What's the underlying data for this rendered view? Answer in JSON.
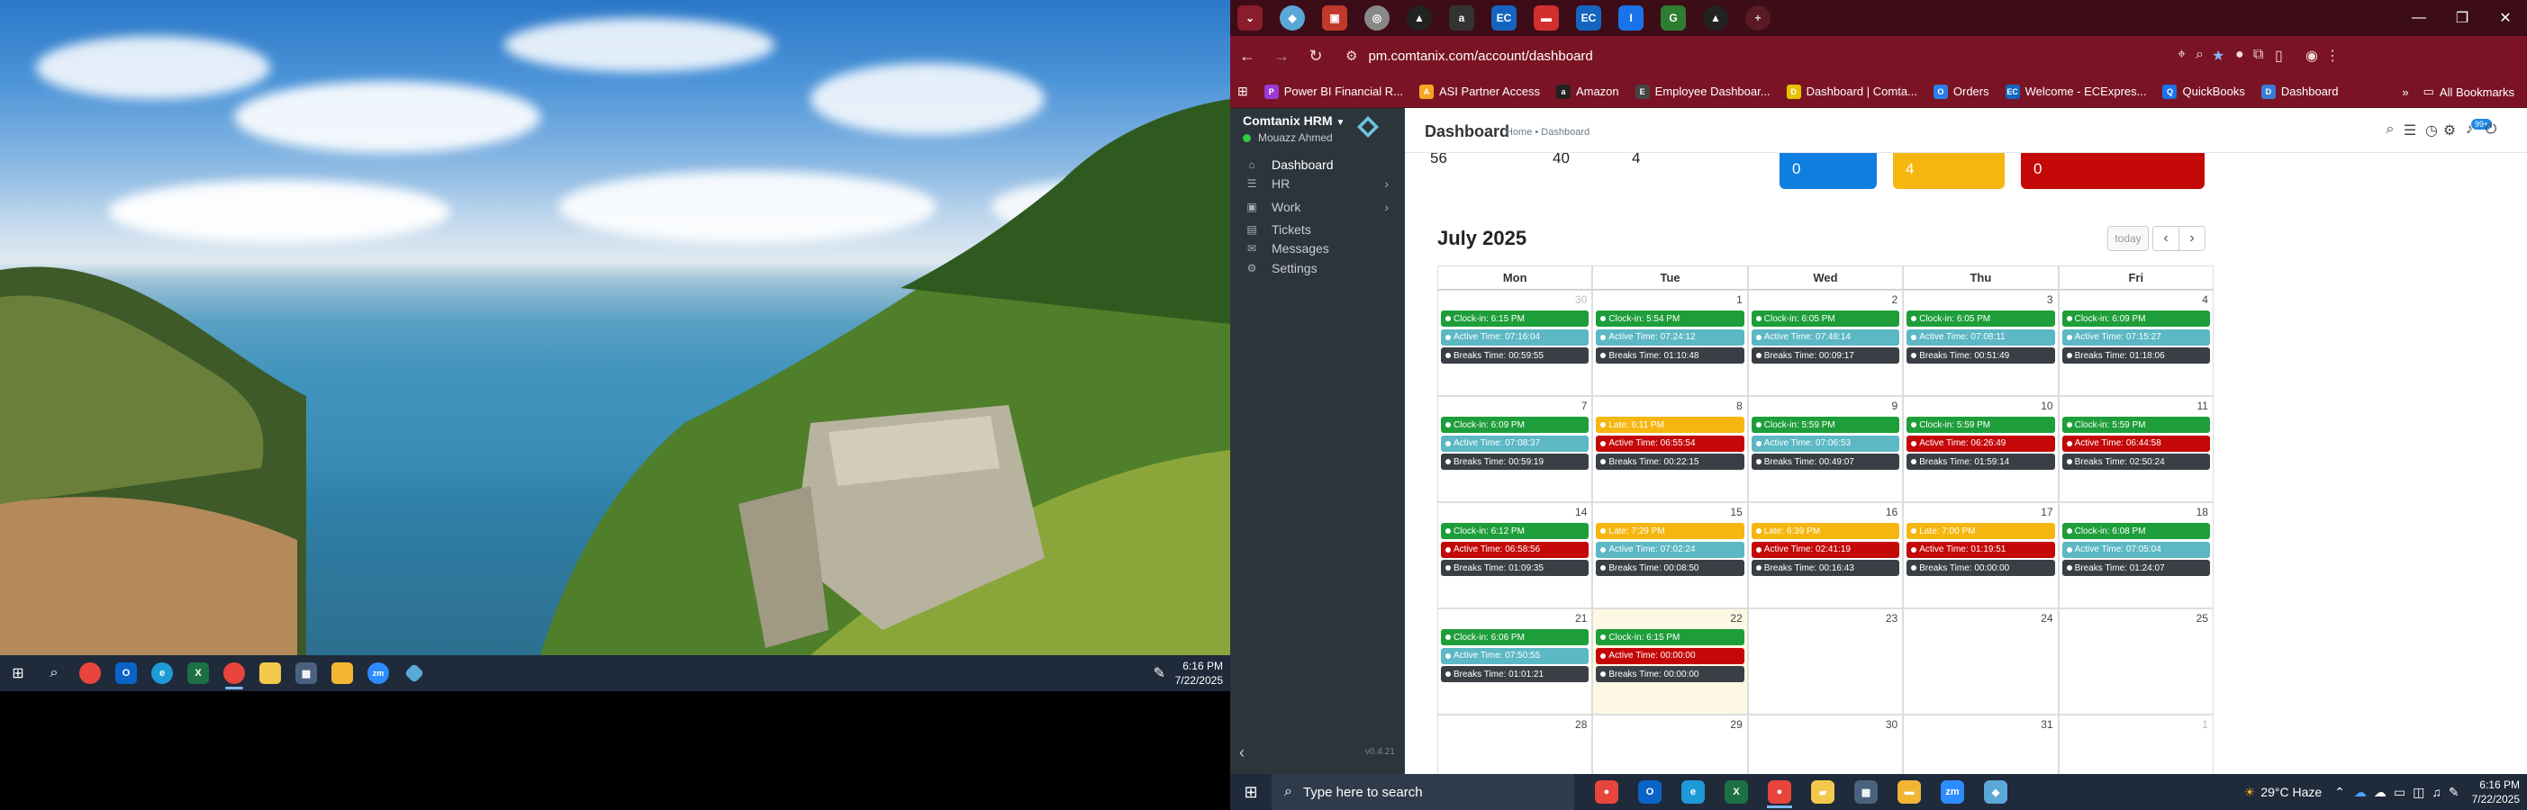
{
  "colors": {
    "green": "#1e9e3a",
    "teal": "#5bb8c4",
    "dark": "#3a3f45",
    "yellow": "#f5b70f",
    "red": "#c40707",
    "blue": "#0e7ee0"
  },
  "desktop_left": {
    "taskbar_icons": [
      "windows-start-icon",
      "search-icon",
      "chrome-icon",
      "outlook-icon",
      "edge-icon",
      "excel-icon",
      "chrome-active-icon",
      "sticky-notes-icon",
      "calculator-icon",
      "file-explorer-icon",
      "zoom-icon",
      "comtanix-icon"
    ],
    "clock": {
      "time": "6:16 PM",
      "date": "7/22/2025"
    }
  },
  "browser": {
    "url": "pm.comtanix.com/account/dashboard",
    "bookmarks": [
      {
        "label": "Power BI Financial R...",
        "color": "#9b3ad6",
        "glyph": "P"
      },
      {
        "label": "ASI Partner Access",
        "color": "#f5a623",
        "glyph": "A"
      },
      {
        "label": "Amazon",
        "color": "#222",
        "glyph": "a"
      },
      {
        "label": "Employee Dashboar...",
        "color": "#444",
        "glyph": "E"
      },
      {
        "label": "Dashboard | Comta...",
        "color": "#e6c200",
        "glyph": "D"
      },
      {
        "label": "Orders",
        "color": "#2b7de9",
        "glyph": "O"
      },
      {
        "label": "Welcome - ECExpres...",
        "color": "#1565c0",
        "glyph": "EC"
      },
      {
        "label": "QuickBooks",
        "color": "#1a73e8",
        "glyph": "Q"
      },
      {
        "label": "Dashboard",
        "color": "#3a7bd5",
        "glyph": "D"
      }
    ],
    "all_bookmarks": "All Bookmarks"
  },
  "app": {
    "brand": "Comtanix HRM",
    "user": "Mouazz Ahmed",
    "version": "v0.4.21",
    "menu": [
      {
        "label": "Dashboard",
        "icon": "home-icon",
        "glyph": "⌂",
        "chev": ""
      },
      {
        "label": "HR",
        "icon": "users-icon",
        "glyph": "☰",
        "chev": "›"
      },
      {
        "label": "Work",
        "icon": "briefcase-icon",
        "glyph": "▣",
        "chev": "›"
      },
      {
        "label": "Tickets",
        "icon": "ticket-icon",
        "glyph": "▤",
        "chev": ""
      },
      {
        "label": "Messages",
        "icon": "message-icon",
        "glyph": "✉",
        "chev": ""
      },
      {
        "label": "Settings",
        "icon": "gear-icon",
        "glyph": "⚙",
        "chev": ""
      }
    ],
    "page_title": "Dashboard",
    "breadcrumb": "Home • Dashboard",
    "notification_count": "99+",
    "stats": [
      "56",
      "40",
      "4"
    ],
    "status_boxes": [
      "0",
      "4",
      "0"
    ]
  },
  "calendar": {
    "title": "July 2025",
    "today_label": "today",
    "days": [
      "Mon",
      "Tue",
      "Wed",
      "Thu",
      "Fri"
    ],
    "weeks": [
      [
        {
          "d": "30",
          "other": true,
          "ev": [
            [
              "Clock-in: 6:15 PM",
              "green"
            ],
            [
              "Active Time: 07:16:04",
              "teal"
            ],
            [
              "Breaks Time: 00:59:55",
              "dark"
            ]
          ]
        },
        {
          "d": "1",
          "ev": [
            [
              "Clock-in: 5:54 PM",
              "green"
            ],
            [
              "Active Time: 07:24:12",
              "teal"
            ],
            [
              "Breaks Time: 01:10:48",
              "dark"
            ]
          ]
        },
        {
          "d": "2",
          "ev": [
            [
              "Clock-in: 6:05 PM",
              "green"
            ],
            [
              "Active Time: 07:48:14",
              "teal"
            ],
            [
              "Breaks Time: 00:09:17",
              "dark"
            ]
          ]
        },
        {
          "d": "3",
          "ev": [
            [
              "Clock-in: 6:05 PM",
              "green"
            ],
            [
              "Active Time: 07:08:11",
              "teal"
            ],
            [
              "Breaks Time: 00:51:49",
              "dark"
            ]
          ]
        },
        {
          "d": "4",
          "ev": [
            [
              "Clock-in: 6:09 PM",
              "green"
            ],
            [
              "Active Time: 07:15:27",
              "teal"
            ],
            [
              "Breaks Time: 01:18:06",
              "dark"
            ]
          ]
        }
      ],
      [
        {
          "d": "7",
          "ev": [
            [
              "Clock-in: 6:09 PM",
              "green"
            ],
            [
              "Active Time: 07:08:37",
              "teal"
            ],
            [
              "Breaks Time: 00:59:19",
              "dark"
            ]
          ]
        },
        {
          "d": "8",
          "ev": [
            [
              "Late: 6:11 PM",
              "yellow"
            ],
            [
              "Active Time: 06:55:54",
              "red"
            ],
            [
              "Breaks Time: 00:22:15",
              "dark"
            ]
          ]
        },
        {
          "d": "9",
          "ev": [
            [
              "Clock-in: 5:59 PM",
              "green"
            ],
            [
              "Active Time: 07:06:53",
              "teal"
            ],
            [
              "Breaks Time: 00:49:07",
              "dark"
            ]
          ]
        },
        {
          "d": "10",
          "ev": [
            [
              "Clock-in: 5:59 PM",
              "green"
            ],
            [
              "Active Time: 06:26:49",
              "red"
            ],
            [
              "Breaks Time: 01:59:14",
              "dark"
            ]
          ]
        },
        {
          "d": "11",
          "ev": [
            [
              "Clock-in: 5:59 PM",
              "green"
            ],
            [
              "Active Time: 06:44:58",
              "red"
            ],
            [
              "Breaks Time: 02:50:24",
              "dark"
            ]
          ]
        }
      ],
      [
        {
          "d": "14",
          "ev": [
            [
              "Clock-in: 6:12 PM",
              "green"
            ],
            [
              "Active Time: 06:58:56",
              "red"
            ],
            [
              "Breaks Time: 01:09:35",
              "dark"
            ]
          ]
        },
        {
          "d": "15",
          "ev": [
            [
              "Late: 7:29 PM",
              "yellow"
            ],
            [
              "Active Time: 07:02:24",
              "teal"
            ],
            [
              "Breaks Time: 00:08:50",
              "dark"
            ]
          ]
        },
        {
          "d": "16",
          "ev": [
            [
              "Late: 6:39 PM",
              "yellow"
            ],
            [
              "Active Time: 02:41:19",
              "red"
            ],
            [
              "Breaks Time: 00:16:43",
              "dark"
            ]
          ]
        },
        {
          "d": "17",
          "ev": [
            [
              "Late: 7:00 PM",
              "yellow"
            ],
            [
              "Active Time: 01:19:51",
              "red"
            ],
            [
              "Breaks Time: 00:00:00",
              "dark"
            ]
          ]
        },
        {
          "d": "18",
          "ev": [
            [
              "Clock-in: 6:08 PM",
              "green"
            ],
            [
              "Active Time: 07:05:04",
              "teal"
            ],
            [
              "Breaks Time: 01:24:07",
              "dark"
            ]
          ]
        }
      ],
      [
        {
          "d": "21",
          "ev": [
            [
              "Clock-in: 6:06 PM",
              "green"
            ],
            [
              "Active Time: 07:50:55",
              "teal"
            ],
            [
              "Breaks Time: 01:01:21",
              "dark"
            ]
          ]
        },
        {
          "d": "22",
          "today": true,
          "ev": [
            [
              "Clock-in: 6:15 PM",
              "green"
            ],
            [
              "Active Time: 00:00:00",
              "red"
            ],
            [
              "Breaks Time: 00:00:00",
              "dark"
            ]
          ]
        },
        {
          "d": "23",
          "ev": []
        },
        {
          "d": "24",
          "ev": []
        },
        {
          "d": "25",
          "ev": []
        }
      ],
      [
        {
          "d": "28",
          "ev": []
        },
        {
          "d": "29",
          "ev": []
        },
        {
          "d": "30",
          "ev": []
        },
        {
          "d": "31",
          "ev": []
        },
        {
          "d": "1",
          "other": true,
          "ev": []
        }
      ]
    ]
  },
  "taskbar": {
    "search_placeholder": "Type here to search",
    "apps": [
      {
        "name": "chrome-icon",
        "color": "#e8453c",
        "glyph": "●"
      },
      {
        "name": "outlook-icon",
        "color": "#0a64c8",
        "glyph": "O"
      },
      {
        "name": "edge-icon",
        "color": "#1d9bd6",
        "glyph": "e"
      },
      {
        "name": "excel-icon",
        "color": "#1d7044",
        "glyph": "X"
      },
      {
        "name": "chrome-active-icon",
        "color": "#e8453c",
        "glyph": "●"
      },
      {
        "name": "sticky-notes-icon",
        "color": "#f2c94c",
        "glyph": "▰"
      },
      {
        "name": "calculator-icon",
        "color": "#4a6280",
        "glyph": "▦"
      },
      {
        "name": "file-explorer-icon",
        "color": "#f2b634",
        "glyph": "▬"
      },
      {
        "name": "zoom-icon",
        "color": "#2d8cff",
        "glyph": "zm"
      },
      {
        "name": "comtanix-icon",
        "color": "#5aa8d8",
        "glyph": "◆"
      }
    ],
    "weather": "29°C  Haze",
    "time": "6:16 PM",
    "date": "7/22/2025"
  }
}
